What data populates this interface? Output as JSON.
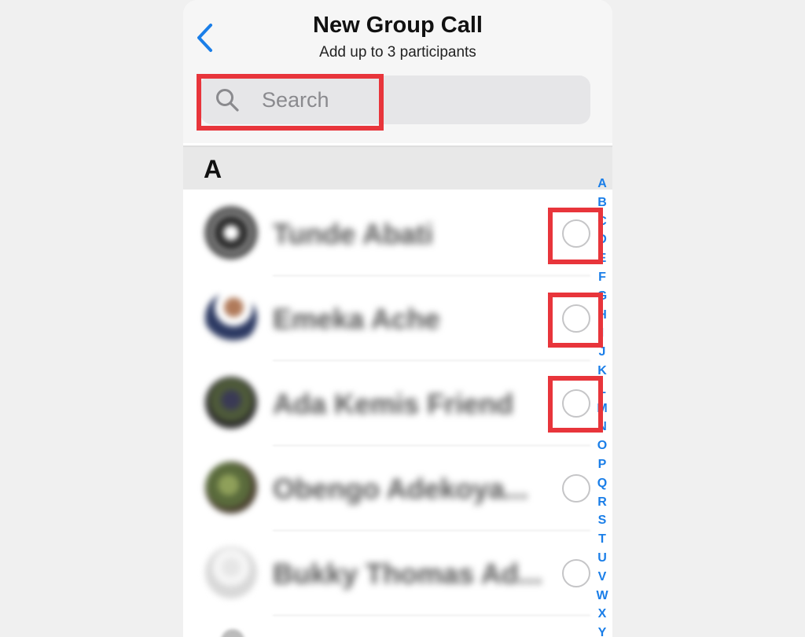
{
  "header": {
    "title": "New Group Call",
    "subtitle": "Add up to 3 participants",
    "back_icon": "chevron-left-icon"
  },
  "search": {
    "placeholder": "Search",
    "value": "",
    "icon": "search-icon"
  },
  "section": {
    "letter": "A"
  },
  "contacts": [
    {
      "name": "Tunde Abati",
      "selected": false
    },
    {
      "name": "Emeka Ache",
      "selected": false
    },
    {
      "name": "Ada Kemis Friend",
      "selected": false
    },
    {
      "name": "Obengo Adekoya...",
      "selected": false
    },
    {
      "name": "Bukky Thomas Ad...",
      "selected": false
    }
  ],
  "index_letters": [
    "A",
    "B",
    "C",
    "D",
    "E",
    "F",
    "G",
    "H",
    "I",
    "J",
    "K",
    "L",
    "M",
    "N",
    "O",
    "P",
    "Q",
    "R",
    "S",
    "T",
    "U",
    "V",
    "W",
    "X",
    "Y"
  ],
  "colors": {
    "accent": "#1a7ee8",
    "highlight": "#e8353b"
  }
}
